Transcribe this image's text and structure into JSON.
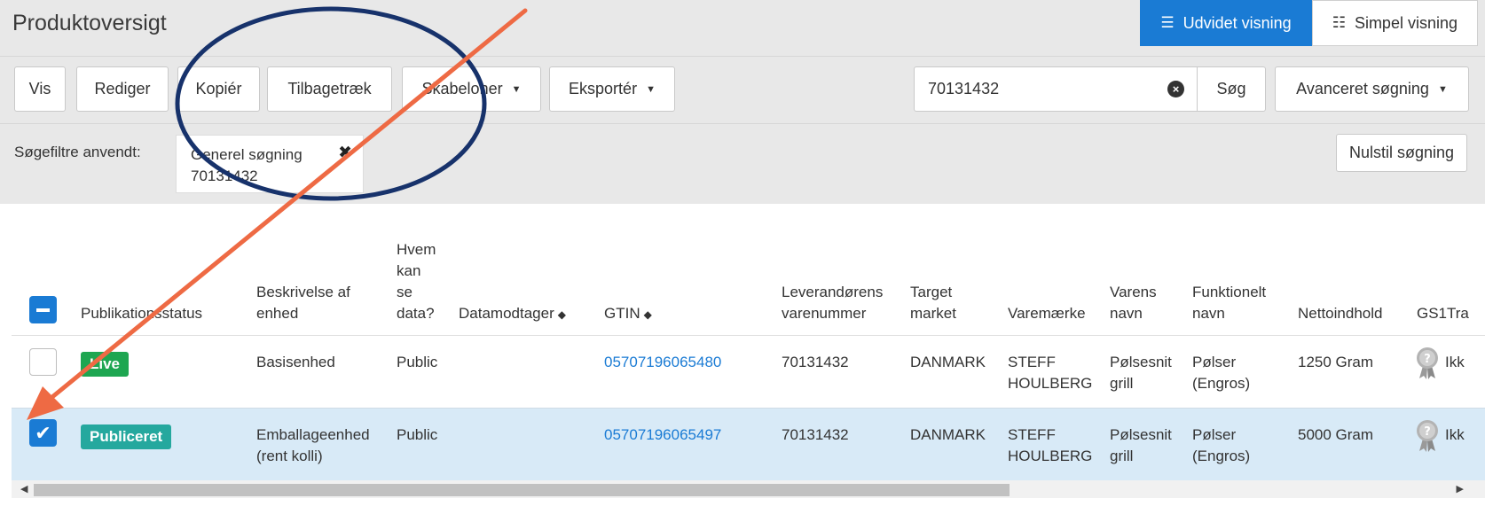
{
  "header": {
    "title": "Produktoversigt",
    "views": [
      {
        "label": "Udvidet visning",
        "icon": "list-icon",
        "active": true
      },
      {
        "label": "Simpel visning",
        "icon": "compact-list-icon",
        "active": false
      }
    ]
  },
  "toolbar": {
    "vis": "Vis",
    "rediger": "Rediger",
    "kopier": "Kopiér",
    "tilbagetraek": "Tilbagetræk",
    "skabeloner": "Skabeloner",
    "eksporter": "Eksportér",
    "search_value": "70131432",
    "search_button": "Søg",
    "advanced_search": "Avanceret søgning"
  },
  "filters": {
    "label": "Søgefiltre anvendt:",
    "chip": {
      "title": "Generel søgning",
      "value": "70131432"
    },
    "reset": "Nulstil søgning"
  },
  "table": {
    "headers": {
      "status": "Publikationsstatus",
      "description": [
        "Beskrivelse af",
        "enhed"
      ],
      "who": [
        "Hvem",
        "kan",
        "se",
        "data?"
      ],
      "receiver": "Datamodtager",
      "gtin": "GTIN",
      "supplier": [
        "Leverandørens",
        "varenummer"
      ],
      "target": [
        "Target",
        "market"
      ],
      "brand": "Varemærke",
      "name": [
        "Varens",
        "navn"
      ],
      "functional": [
        "Funktionelt",
        "navn"
      ],
      "net": "Nettoindhold",
      "gs1": "GS1Tra"
    },
    "rows": [
      {
        "checked": false,
        "status": "Live",
        "status_color": "#1ea651",
        "description": [
          "Basisenhed",
          ""
        ],
        "who": "Public",
        "gtin": "05707196065480",
        "supplier_no": "70131432",
        "target": "DANMARK",
        "brand": [
          "STEFF",
          "HOULBERG"
        ],
        "name": [
          "Pølsesnit",
          "grill"
        ],
        "functional": [
          "Pølser",
          "(Engros)"
        ],
        "net": "1250 Gram",
        "gs1": "Ikk"
      },
      {
        "checked": true,
        "status": "Publiceret",
        "status_color": "#25a89e",
        "description": [
          "Emballageenhed",
          "(rent kolli)"
        ],
        "who": "Public",
        "gtin": "05707196065497",
        "supplier_no": "70131432",
        "target": "DANMARK",
        "brand": [
          "STEFF",
          "HOULBERG"
        ],
        "name": [
          "Pølsesnit",
          "grill"
        ],
        "functional": [
          "Pølser",
          "(Engros)"
        ],
        "net": "5000 Gram",
        "gs1": "Ikk"
      }
    ]
  },
  "annotation": {
    "ellipse_color": "#17326b",
    "arrow_color": "#ee6a44"
  }
}
